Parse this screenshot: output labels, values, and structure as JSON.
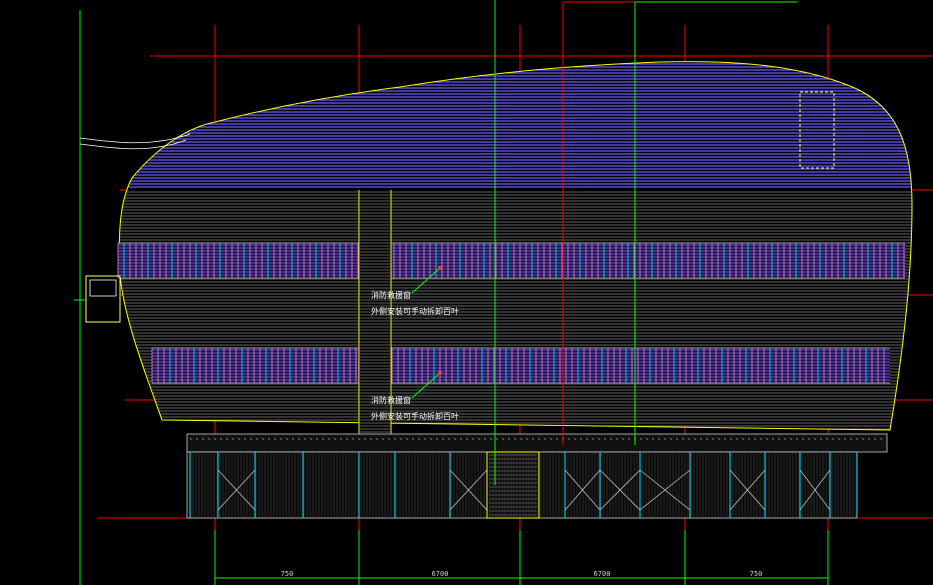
{
  "drawing": {
    "annotations": [
      {
        "line1": "消防救援窗",
        "line2": "外侧安装可手动拆卸百叶"
      },
      {
        "line1": "消防救援窗",
        "line2": "外侧安装可手动拆卸百叶"
      }
    ],
    "dimensions": [
      "750",
      "6700",
      "6700",
      "750"
    ],
    "colors": {
      "background": "#000000",
      "axis_red": "#ff0000",
      "leader_green": "#00ff00",
      "outline_yellow": "#ffff00",
      "roof_band": "#6a5cff",
      "wall_lines": "#c8c8c8",
      "glass_mullion": "#00e5ff",
      "glass_pink": "#ff79c6"
    }
  }
}
